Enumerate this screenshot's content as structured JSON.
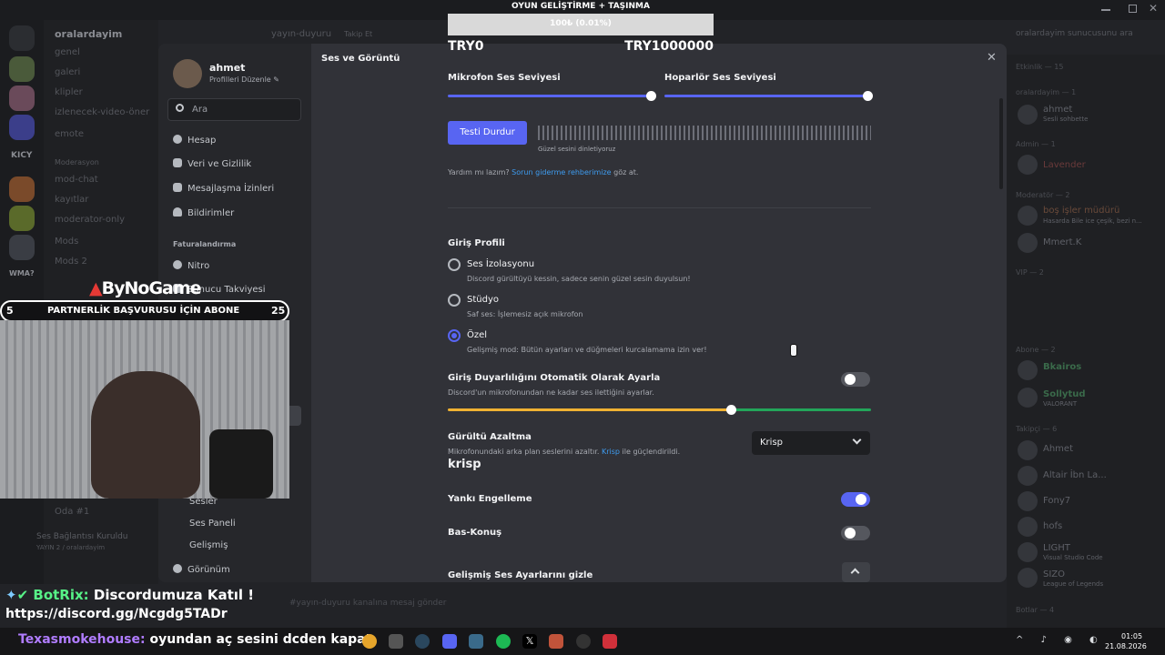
{
  "window": {
    "title": "oralardayim sunucusunu ara"
  },
  "background": {
    "server_name": "oralardayim",
    "top_channel": "yayın-duyuru",
    "follow_label": "Takip Et",
    "server_labels": [
      "KICY",
      "WMA?"
    ],
    "channels": [
      "genel",
      "galeri",
      "klipler",
      "izlenecek-video-öner",
      "emote",
      "Moderasyon",
      "mod-chat",
      "kayıtlar",
      "moderator-only",
      "Mods",
      "Mods 2",
      "Oda #1"
    ],
    "voice_status": "Ses Bağlantısı Kuruldu",
    "voice_sub": "YAYIN 2 / oralardayim",
    "message_placeholder": "#yayın-duyuru kanalına mesaj gönder",
    "member_groups": [
      "Etkinlik — 15",
      "oralardayim — 1",
      "Admin — 1",
      "Moderatör — 2",
      "VIP — 2",
      "Abone — 2",
      "Takipçi — 6",
      "Botlar — 4"
    ],
    "members": [
      "ahmet",
      "Lavender",
      "boş işler müdürü",
      "Mmert.K",
      "Bkairos",
      "Sollytud",
      "Ahmet",
      "Altair İbn La...",
      "Fony7",
      "hofs",
      "LIGHT",
      "SIZO"
    ],
    "member_subs": [
      "Sesli sohbette",
      "Hasarda Bile ice çeşik, bezi n...",
      "VALORANT",
      "Visual Studio Code",
      "League of Legends"
    ]
  },
  "settings_sidebar": {
    "user_name": "ahmet",
    "edit_profile": "Profilleri Düzenle",
    "search_placeholder": "Ara",
    "items": [
      {
        "label": "Hesap",
        "icon": "person-icon"
      },
      {
        "label": "Veri ve Gizlilik",
        "icon": "shield-icon"
      },
      {
        "label": "Mesajlaşma İzinleri",
        "icon": "chat-icon"
      },
      {
        "label": "Bildirimler",
        "icon": "bell-icon"
      }
    ],
    "billing_header": "Faturalandırma",
    "billing_items": [
      {
        "label": "Nitro",
        "icon": "nitro-icon"
      },
      {
        "label": "Sunucu Takviyesi",
        "icon": "boost-icon"
      }
    ],
    "lower_items": [
      "Sesler",
      "Ses Paneli",
      "Gelişmiş",
      "Görünüm"
    ]
  },
  "settings_main": {
    "page_title": "Ses ve Görüntü",
    "mic_volume_label": "Mikrofon Ses Seviyesi",
    "mic_volume_level": 1.0,
    "speaker_volume_label": "Hoparlör Ses Seviyesi",
    "speaker_volume_level": 1.0,
    "test_button": "Testi Durdur",
    "test_caption": "Güzel sesini dinletiyoruz",
    "help_prefix": "Yardım mı lazım? ",
    "help_link": "Sorun giderme rehberimize",
    "help_suffix": " göz at.",
    "input_profile_title": "Giriş Profili",
    "profiles": [
      {
        "title": "Ses İzolasyonu",
        "desc": "Discord gürültüyü kessin, sadece senin güzel sesin duyulsun!",
        "selected": false
      },
      {
        "title": "Stüdyo",
        "desc": "Saf ses: İşlemesiz açık mikrofon",
        "selected": false
      },
      {
        "title": "Özel",
        "desc": "Gelişmiş mod: Bütün ayarları ve düğmeleri kurcalamama izin ver!",
        "selected": true
      }
    ],
    "sensitivity_title": "Giriş Duyarlılığını Otomatik Olarak Ayarla",
    "sensitivity_desc": "Discord'un mikrofonundan ne kadar ses ilettiğini ayarlar.",
    "sensitivity_auto": false,
    "sensitivity_level": 0.67,
    "noise_title": "Gürültü Azaltma",
    "noise_desc_prefix": "Mikrofonundaki arka plan seslerini azaltır. ",
    "noise_desc_link": "Krisp",
    "noise_desc_suffix": " ile güçlendirildi.",
    "noise_select": "Krisp",
    "krisp_logo": "krisp",
    "echo_title": "Yankı Engelleme",
    "echo_on": true,
    "ptt_title": "Bas-Konuş",
    "ptt_on": false,
    "advanced_title": "Gelişmiş Ses Ayarlarını gizle"
  },
  "stream_overlay": {
    "goal_title": "OYUN GELİŞTİRME + TAŞINMA",
    "goal_bar_text": "100₺ (0.01%)",
    "goal_progress": 0.0001,
    "goal_min": "TRY0",
    "goal_max": "TRY1000000",
    "brand": "ByNoGame",
    "sub_goal_left": "5",
    "sub_goal_text": "PARTNERLİK BAŞVURUSU İÇİN ABONE",
    "sub_goal_right": "25",
    "chat_user": "BotRix:",
    "chat_msg": "Discordumuza Katıl !",
    "chat_link": "https://discord.gg/Ncgdg5TADr",
    "ticker_user": "Texasmokehouse:",
    "ticker_msg": "oyundan aç sesini dcden kapat"
  },
  "taskbar": {
    "time": "01:05",
    "date": "21.08.2026"
  },
  "colors": {
    "accent": "#5865f2",
    "link": "#3e9cf0",
    "yellow": "#f0b232",
    "green": "#23a55a",
    "chat_green": "#57f287"
  }
}
